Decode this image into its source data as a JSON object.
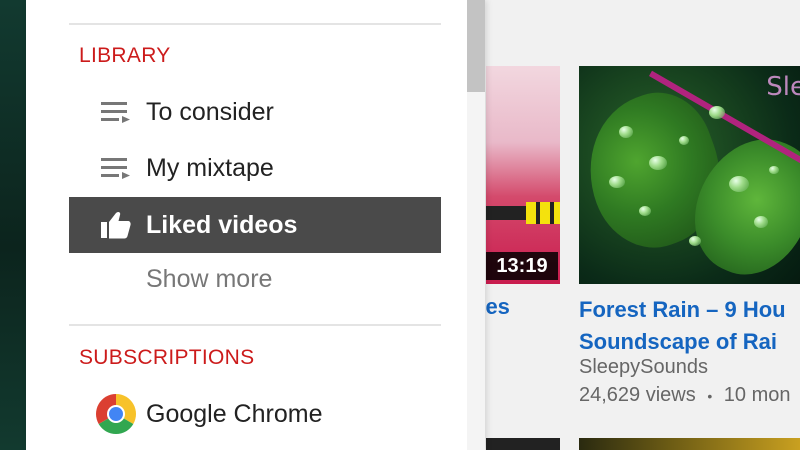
{
  "library": {
    "heading": "LIBRARY",
    "items": [
      {
        "label": "To consider",
        "icon": "playlist-icon",
        "active": false
      },
      {
        "label": "My mixtape",
        "icon": "playlist-icon",
        "active": false
      },
      {
        "label": "Liked videos",
        "icon": "thumbs-up-icon",
        "active": true
      }
    ],
    "show_more": "Show more"
  },
  "subscriptions": {
    "heading": "SUBSCRIPTIONS",
    "items": [
      {
        "label": "Google Chrome",
        "icon": "chrome-logo-icon"
      }
    ]
  },
  "videos": {
    "partial": {
      "duration": "13:19",
      "title_fragment": "nes"
    },
    "main": {
      "overlay_text": "Sle",
      "title_line1": "Forest Rain – 9 Hou",
      "title_line2": "Soundscape of Rai",
      "channel": "SleepySounds",
      "views": "24,629 views",
      "separator": "•",
      "age": "10 mon"
    }
  },
  "colors": {
    "section_heading": "#cc1b1b",
    "active_item_bg": "#4a4a4a",
    "link_title": "#1565c0"
  }
}
